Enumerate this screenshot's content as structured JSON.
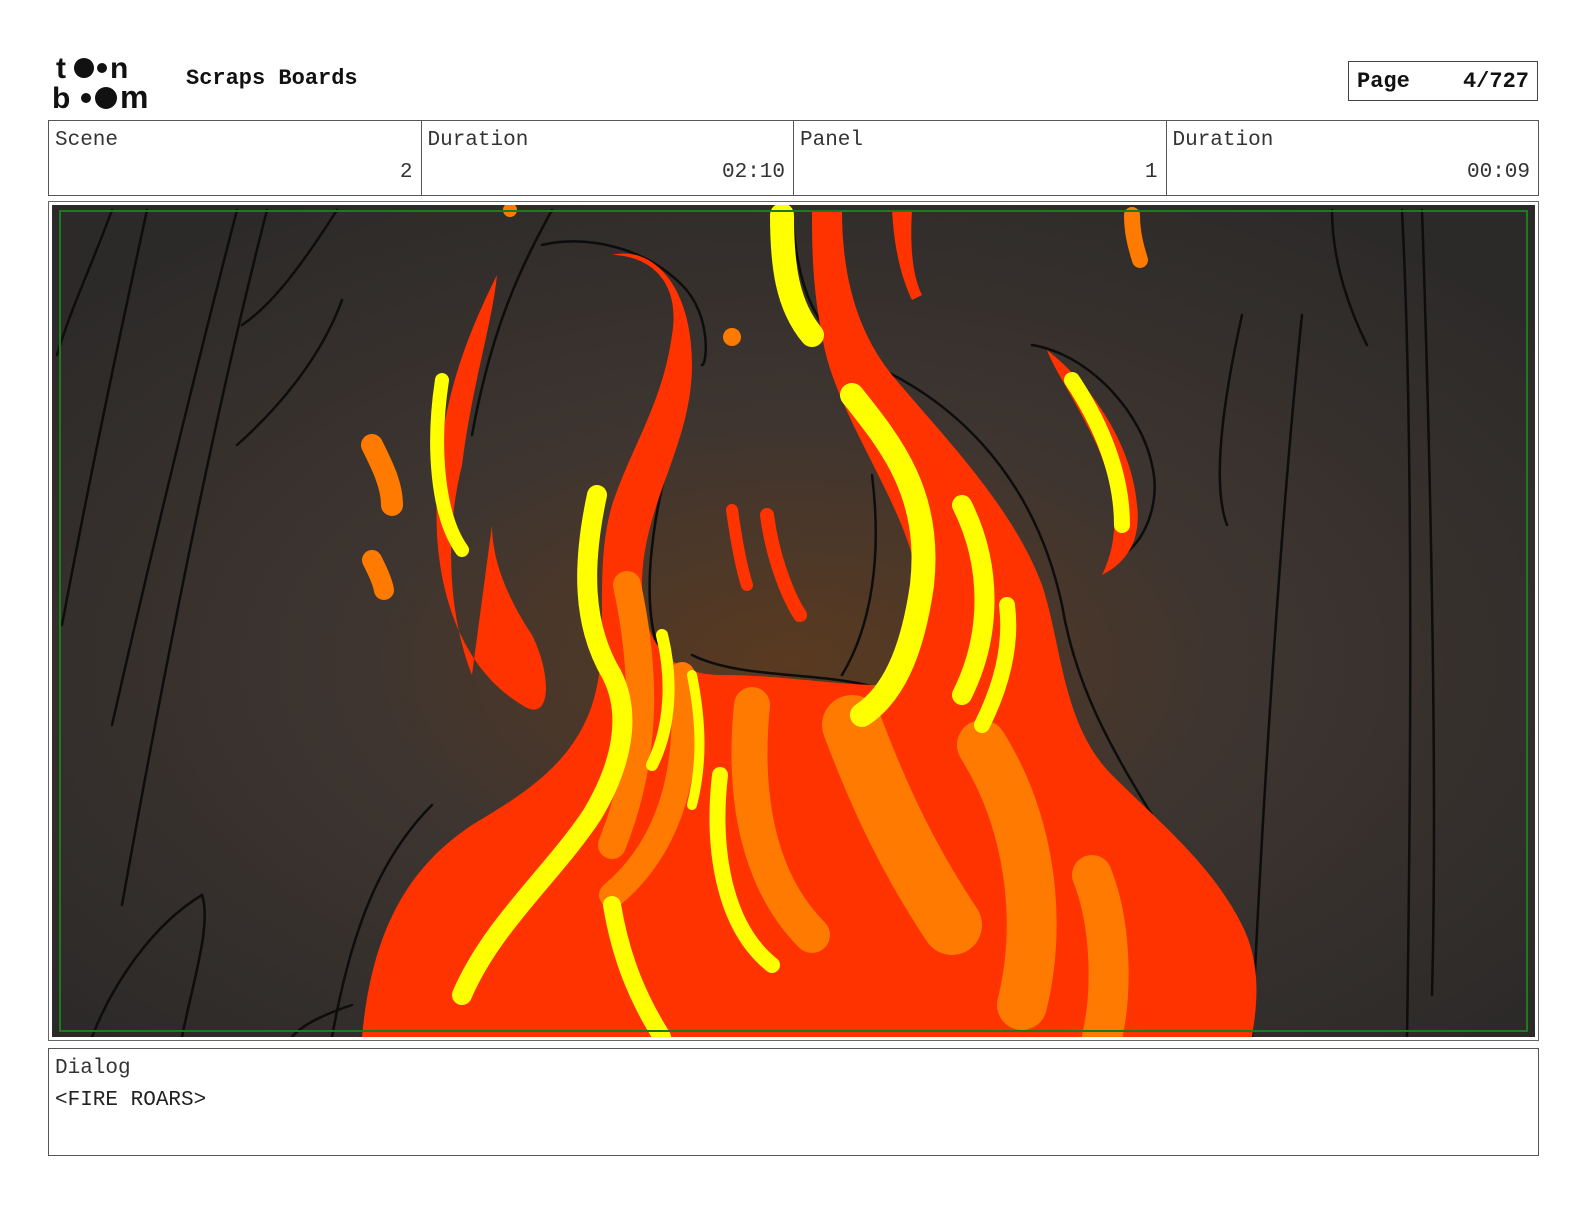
{
  "header": {
    "logo_text": "toon boom",
    "project_title": "Scraps Boards",
    "page_label": "Page",
    "page_value": "4/727"
  },
  "info": {
    "scene_label": "Scene",
    "scene_value": "2",
    "scene_duration_label": "Duration",
    "scene_duration_value": "02:10",
    "panel_label": "Panel",
    "panel_value": "1",
    "panel_duration_label": "Duration",
    "panel_duration_value": "00:09"
  },
  "dialog": {
    "label": "Dialog",
    "text": "<FIRE ROARS>"
  },
  "colors": {
    "fire_red": "#ff3300",
    "fire_orange": "#ff7a00",
    "fire_yellow": "#ffff00",
    "background_dark": "#3a3531",
    "safe_area_green": "#1f7a1f"
  }
}
